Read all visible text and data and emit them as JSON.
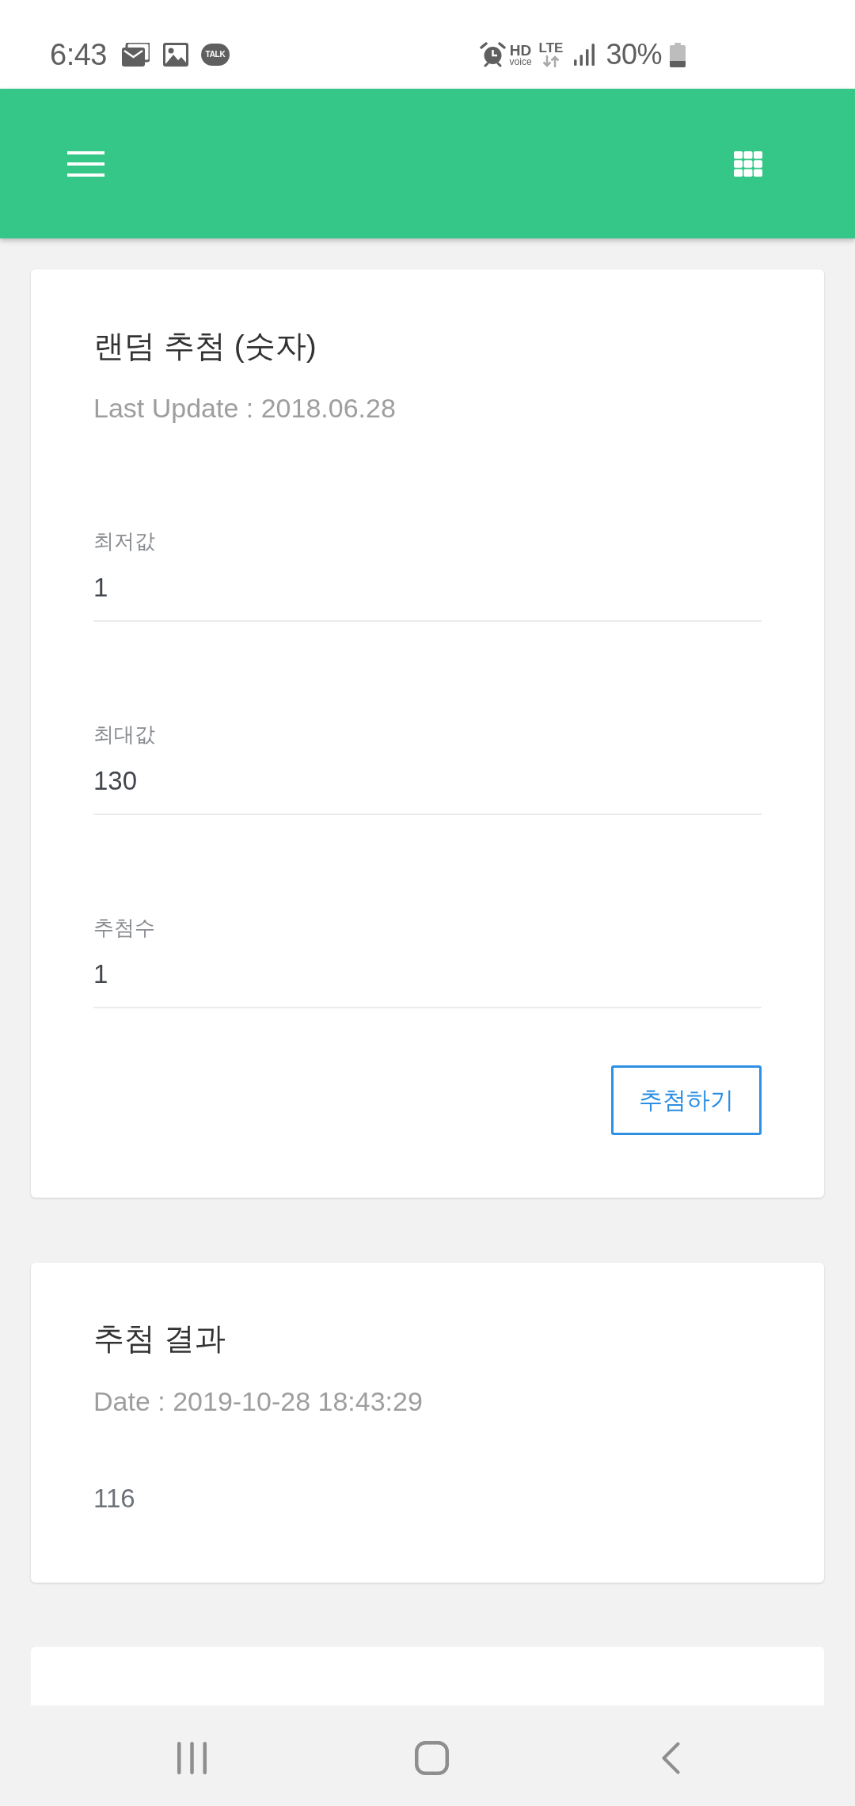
{
  "status_bar": {
    "time": "6:43",
    "chat_badge": "TALK",
    "hd_voice": [
      "HD",
      "voice"
    ],
    "network": "LTE",
    "battery": "30%"
  },
  "draw_card": {
    "title": "랜덤 추첨 (숫자)",
    "subtitle": "Last Update : 2018.06.28",
    "fields": [
      {
        "label": "최저값",
        "value": "1"
      },
      {
        "label": "최대값",
        "value": "130"
      },
      {
        "label": "추첨수",
        "value": "1"
      }
    ],
    "button": "추첨하기"
  },
  "result_card": {
    "title": "추첨 결과",
    "subtitle": "Date : 2019-10-28 18:43:29",
    "result": "116"
  }
}
